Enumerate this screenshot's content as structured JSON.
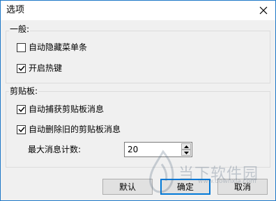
{
  "window": {
    "title": "选项"
  },
  "general": {
    "label": "一般:",
    "options": [
      {
        "label": "自动隐藏菜单条",
        "checked": false
      },
      {
        "label": "开启热键",
        "checked": true
      }
    ]
  },
  "clipboard": {
    "label": "剪贴板:",
    "options": [
      {
        "label": "自动捕获剪贴板消息",
        "checked": true
      },
      {
        "label": "自动删除旧的剪贴板消息",
        "checked": true
      }
    ],
    "max_label": "最大消息计数:",
    "max_value": "20"
  },
  "buttons": {
    "default": "默认",
    "ok": "确定",
    "cancel": "取消"
  },
  "watermark": {
    "text": "当下软件园",
    "url": "www.downxia.com"
  },
  "colors": {
    "accent": "#0078d7",
    "border": "#1e78c8"
  }
}
